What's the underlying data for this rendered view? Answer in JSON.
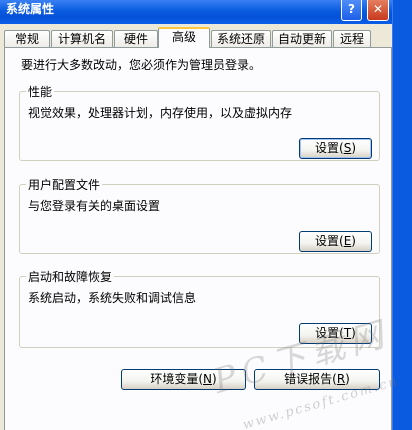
{
  "window": {
    "title": "系统属性",
    "help_glyph": "?",
    "close_glyph": "✕"
  },
  "tabs": [
    {
      "label": "常规",
      "active": false
    },
    {
      "label": "计算机名",
      "active": false
    },
    {
      "label": "硬件",
      "active": false
    },
    {
      "label": "高级",
      "active": true
    },
    {
      "label": "系统还原",
      "active": false
    },
    {
      "label": "自动更新",
      "active": false
    },
    {
      "label": "远程",
      "active": false
    }
  ],
  "notice": "要进行大多数改动，您必须作为管理员登录。",
  "groups": {
    "performance": {
      "title": "性能",
      "description": "视觉效果，处理器计划，内存使用，以及虚拟内存",
      "button": "设置",
      "mnemonic": "S"
    },
    "user_profiles": {
      "title": "用户配置文件",
      "description": "与您登录有关的桌面设置",
      "button": "设置",
      "mnemonic": "E"
    },
    "startup_recovery": {
      "title": "启动和故障恢复",
      "description": "系统启动，系统失败和调试信息",
      "button": "设置",
      "mnemonic": "T"
    }
  },
  "bottom_buttons": {
    "env_vars": {
      "label": "环境变量",
      "mnemonic": "N"
    },
    "error_report": {
      "label": "错误报告",
      "mnemonic": "R"
    }
  },
  "watermark": {
    "text": "PC下载网",
    "url": "www.pcsoft.com.cn"
  }
}
